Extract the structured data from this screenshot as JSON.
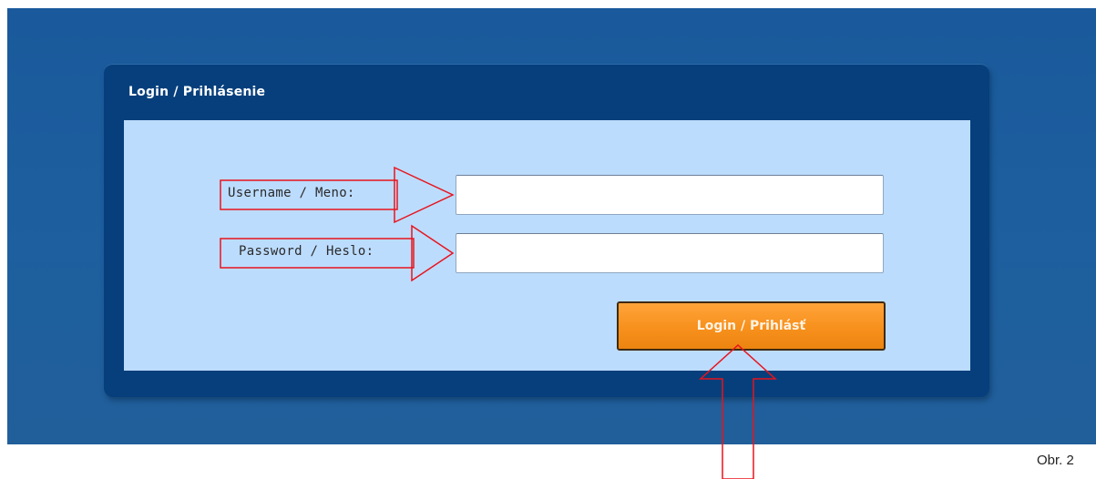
{
  "login_panel": {
    "title": "Login / Prihlásenie",
    "username_label": "Username / Meno:",
    "password_label": "Password / Heslo:",
    "username_value": "",
    "password_value": "",
    "login_button_label": "Login / Prihlásť"
  },
  "caption": "Obr. 2",
  "colors": {
    "background_blue": "#1d5f9f",
    "panel_navy": "#063f7c",
    "panel_body": "#bcdcfe",
    "button_orange": "#f7901c",
    "annotation_red": "#e8141c"
  },
  "annotations": {
    "arrow_icons": [
      "arrow-right-icon",
      "arrow-right-icon",
      "arrow-up-icon"
    ],
    "highlight_boxes": [
      "username-label-box",
      "password-label-box"
    ]
  }
}
